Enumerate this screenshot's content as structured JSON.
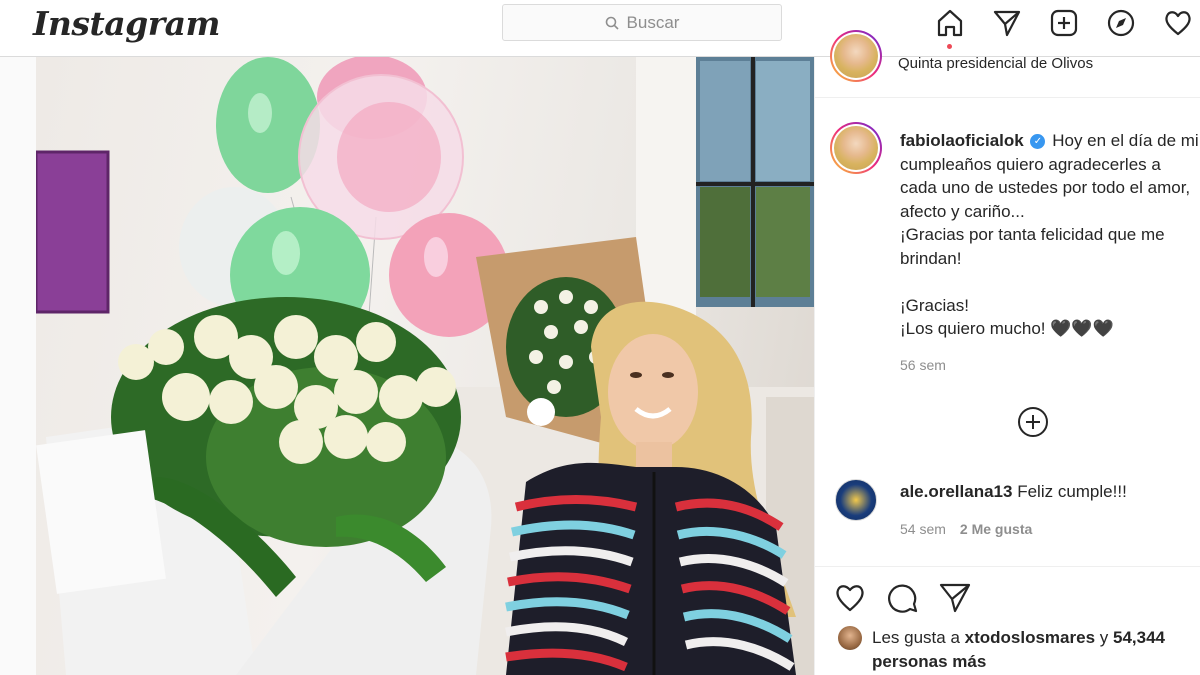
{
  "header": {
    "logo": "Instagram",
    "search_placeholder": "Buscar"
  },
  "nav_icons": [
    "home-icon",
    "direct-icon",
    "new-post-icon",
    "explore-icon",
    "activity-icon"
  ],
  "post": {
    "location": "Quinta presidencial de Olivos",
    "caption": {
      "username": "fabiolaoficialok",
      "text": "Hoy en el día de mi cumpleaños quiero agradecerles a cada uno de ustedes por todo el amor, afecto y cariño...\n¡Gracias por tanta felicidad que me brindan!\n\n¡Gracias!\n¡Los quiero mucho! 🖤🖤🖤",
      "time": "56 sem"
    },
    "comment": {
      "username": "ale.orellana13",
      "text": "Feliz cumple!!!",
      "time": "54 sem",
      "likes": "2 Me gusta"
    },
    "likes": {
      "prefix": "Les gusta a",
      "user": "xtodoslosmares",
      "connector": "y",
      "count": "54,344 personas más"
    }
  },
  "colors": {
    "accent": "#3897f0",
    "notification": "#ed4956",
    "text": "#262626",
    "muted": "#8e8e8e"
  }
}
